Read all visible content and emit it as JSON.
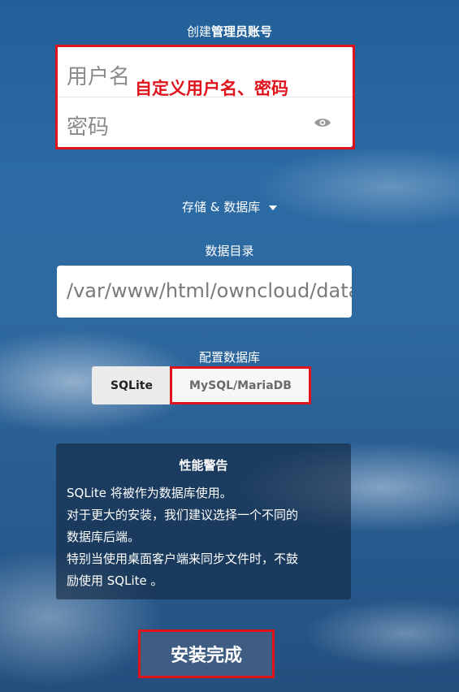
{
  "admin_section": {
    "title_prefix": "创建",
    "title_bold": "管理员账号",
    "username_placeholder": "用户名",
    "password_placeholder": "密码",
    "annotation": "自定义用户名、密码"
  },
  "storage": {
    "toggle_label": "存储 & 数据库",
    "data_dir_label": "数据目录",
    "data_dir_value": "/var/www/html/owncloud/data"
  },
  "database": {
    "label": "配置数据库",
    "options": [
      "SQLite",
      "MySQL/MariaDB"
    ]
  },
  "warning": {
    "title": "性能警告",
    "lines": [
      "SQLite 将被作为数据库使用。",
      "对于更大的安装，我们建议选择一个不同的",
      "数据库后端。",
      "特别当使用桌面客户端来同步文件时，不鼓",
      "励使用 SQLite 。"
    ]
  },
  "finish_button": "安装完成",
  "colors": {
    "annotation_red": "#e0121b",
    "button_blue": "#3f5d83",
    "background_blue": "#2b6aa4"
  }
}
